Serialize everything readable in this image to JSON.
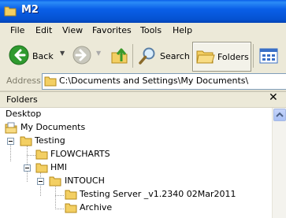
{
  "window": {
    "title": "M2"
  },
  "menu": {
    "items": [
      "File",
      "Edit",
      "View",
      "Favorites",
      "Tools",
      "Help"
    ]
  },
  "toolbar": {
    "back_label": "Back",
    "search_label": "Search",
    "folders_label": "Folders"
  },
  "address": {
    "label": "Address",
    "value": "C:\\Documents and Settings\\My Documents\\"
  },
  "folders_pane": {
    "title": "Folders",
    "tree": [
      {
        "label": "Desktop"
      },
      {
        "label": "My Documents"
      },
      {
        "label": "Testing"
      },
      {
        "label": "FLOWCHARTS"
      },
      {
        "label": "HMI"
      },
      {
        "label": "INTOUCH"
      },
      {
        "label": "Testing Server _v1.2340 02Mar2011"
      },
      {
        "label": "Archive"
      }
    ]
  },
  "colors": {
    "titlebar": "#0a5fe8",
    "folder": "#f3cf63",
    "back_arrow": "#2f9a2f",
    "up_arrow": "#3a9a2a"
  }
}
